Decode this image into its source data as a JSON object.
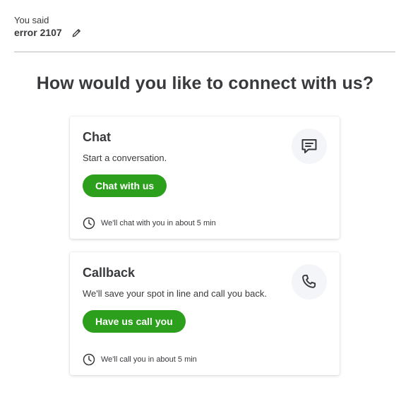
{
  "query": {
    "label": "You said",
    "text": "error 2107",
    "edit_icon": "pencil-icon"
  },
  "heading": "How would you like to connect with us?",
  "options": [
    {
      "title": "Chat",
      "description": "Start a conversation.",
      "button_label": "Chat with us",
      "icon": "chat-bubble-icon",
      "wait_icon": "clock-icon",
      "wait_text": "We'll chat with you in about 5 min"
    },
    {
      "title": "Callback",
      "description": "We'll save your spot in line and call you back.",
      "button_label": "Have us call you",
      "icon": "phone-icon",
      "wait_icon": "clock-icon",
      "wait_text": "We'll call you in about 5 min"
    }
  ],
  "colors": {
    "accent": "#2ca01c",
    "text": "#393a3d",
    "icon_circle": "#f4f5f8",
    "divider": "#bababc"
  }
}
